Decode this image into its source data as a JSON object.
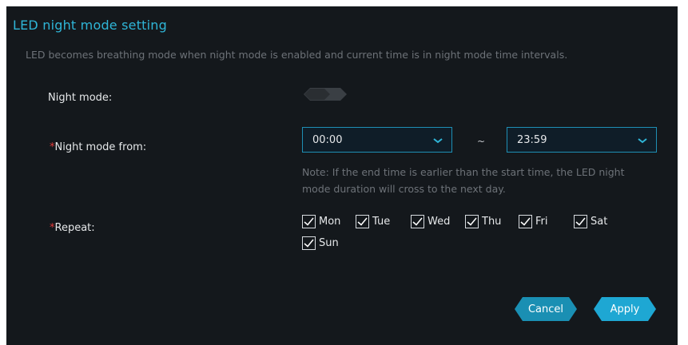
{
  "panel": {
    "title": "LED night mode setting",
    "description": "LED becomes breathing mode when night mode is enabled and current time is in night mode time intervals."
  },
  "night_mode": {
    "label": "Night mode:",
    "enabled": false
  },
  "night_mode_from": {
    "required_mark": "*",
    "label": "Night mode from:",
    "start": "00:00",
    "separator": "~",
    "end": "23:59",
    "note": "Note: If the end time is earlier than the start time, the LED night mode duration will cross to the next day."
  },
  "repeat": {
    "required_mark": "*",
    "label": "Repeat:",
    "days": [
      {
        "label": "Mon",
        "checked": true
      },
      {
        "label": "Tue",
        "checked": true
      },
      {
        "label": "Wed",
        "checked": true
      },
      {
        "label": "Thu",
        "checked": true
      },
      {
        "label": "Fri",
        "checked": true
      },
      {
        "label": "Sat",
        "checked": true
      },
      {
        "label": "Sun",
        "checked": true
      }
    ]
  },
  "actions": {
    "cancel_label": "Cancel",
    "apply_label": "Apply"
  },
  "colors": {
    "background": "#14181c",
    "accent": "#2fb6d8",
    "required": "#e23b3b"
  }
}
